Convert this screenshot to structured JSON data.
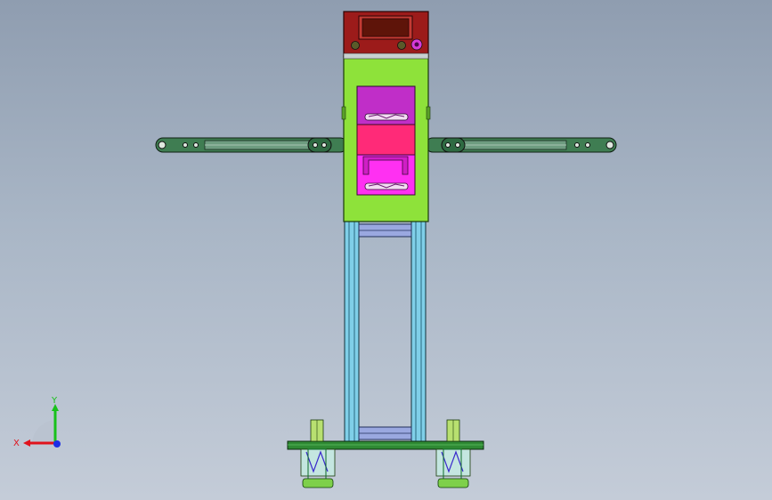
{
  "triad": {
    "x_label": "X",
    "y_label": "Y",
    "x_color": "#e0131c",
    "y_color": "#18c11a",
    "z_color": "#1c2ee6"
  },
  "model": {
    "colors": {
      "controller_housing": "#9c1b1a",
      "controller_screen": "#5e1409",
      "column_body": "#8ee23a",
      "upper_panel": "#c02ec8",
      "middle_panel": "#ff2a78",
      "lower_panel": "#ff30f2",
      "arm": "#3f7d52",
      "rail": "#7fcfe8",
      "base_plate": "#2f8a34",
      "foot": "#7ed04a"
    }
  }
}
